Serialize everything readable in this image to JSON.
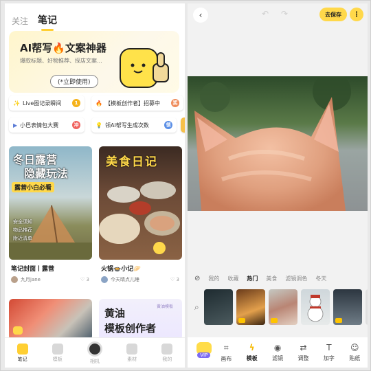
{
  "left": {
    "tabs": [
      {
        "label": "关注"
      },
      {
        "label": "笔记"
      }
    ],
    "banner": {
      "title": "AI帮写🔥文案神器",
      "subtitle": "爆款标题、好物推荐、探店文案...",
      "cta": "(*立即使用)"
    },
    "chips": [
      {
        "label": "Live图记录瞬间",
        "badge": "1"
      },
      {
        "label": "【模板创作者】招募中",
        "badge": "奖"
      },
      {
        "label": "小巴表情包大赛",
        "badge": "冲"
      },
      {
        "label": "领AI帮写生成次数",
        "badge": "领"
      }
    ],
    "cards": [
      {
        "image_headline": "冬日露营",
        "image_headline2": "隐藏玩法",
        "image_tag": "露营小白必看",
        "image_list": [
          "安全须知",
          "物品推荐",
          "附近清单"
        ],
        "title": "笔记封面丨露营",
        "author": "九月jane",
        "likes": "3"
      },
      {
        "image_headline": "美食日记",
        "title": "火锅🍲小记🥟",
        "author": "今天晴点儿睡",
        "likes": "3"
      },
      {
        "image_headline": "",
        "title": "",
        "author": "",
        "likes": ""
      },
      {
        "image_headline": "黄油",
        "image_headline2": "模板创作者",
        "image_tag": "黄油模板",
        "title": "",
        "author": "",
        "likes": ""
      }
    ],
    "nav": [
      {
        "label": "笔记"
      },
      {
        "label": "模板"
      },
      {
        "label": "相机"
      },
      {
        "label": "素材"
      },
      {
        "label": "我的"
      }
    ]
  },
  "right": {
    "save_label": "去保存",
    "more_label": "⋮",
    "filter_tabs": [
      "我的",
      "收藏",
      "热门",
      "美食",
      "滤镜调色",
      "冬天"
    ],
    "active_filter": "热门",
    "vip_label": "VIP",
    "tools": [
      {
        "label": "画布",
        "icon": "crop-icon"
      },
      {
        "label": "模板",
        "icon": "bolt-icon"
      },
      {
        "label": "滤镜",
        "icon": "filter-icon"
      },
      {
        "label": "调整",
        "icon": "adjust-icon"
      },
      {
        "label": "加字",
        "icon": "text-icon"
      },
      {
        "label": "贴纸",
        "icon": "sticker-icon"
      }
    ],
    "active_tool": "模板"
  },
  "colors": {
    "accent": "#ffcf33",
    "save_button": "#ffd84a",
    "vip_purple": "#7c6cf2"
  }
}
